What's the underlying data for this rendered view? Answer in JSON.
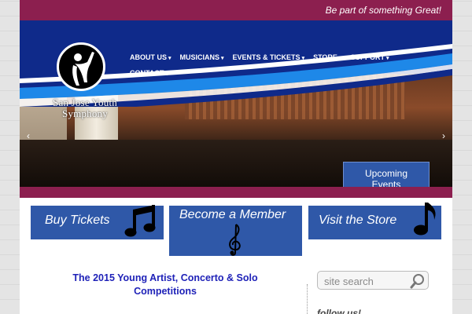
{
  "header": {
    "tagline": "Be part of something Great!"
  },
  "brand": {
    "name_line1": "San Jose Youth",
    "name_line2": "Symphony",
    "logo_icon": "conductor-figure-icon"
  },
  "nav": {
    "items": [
      {
        "label": "ABOUT US"
      },
      {
        "label": "MUSICIANS"
      },
      {
        "label": "EVENTS & TICKETS"
      },
      {
        "label": "STORE"
      },
      {
        "label": "SUPPORT"
      },
      {
        "label": "CONTACT"
      }
    ],
    "caret": "▾"
  },
  "slider": {
    "prev": "‹",
    "next": "›",
    "upcoming_line1": "Upcoming",
    "upcoming_line2": "Events",
    "slide_count": 5,
    "active_slide": 1
  },
  "cta": {
    "tickets": "Buy Tickets",
    "member": "Become a Member",
    "store": "Visit the Store",
    "tickets_icon": "beamed-notes-icon",
    "member_icon": "treble-clef-icon",
    "store_icon": "eighth-note-icon"
  },
  "main": {
    "headline": "The 2015 Young Artist, Concerto & Solo Competitions"
  },
  "sidebar": {
    "search_placeholder": "site search",
    "follow_label": "follow us!"
  },
  "colors": {
    "maroon": "#8c1f4f",
    "blue": "#2f58a8",
    "headline_blue": "#1f22b8"
  }
}
